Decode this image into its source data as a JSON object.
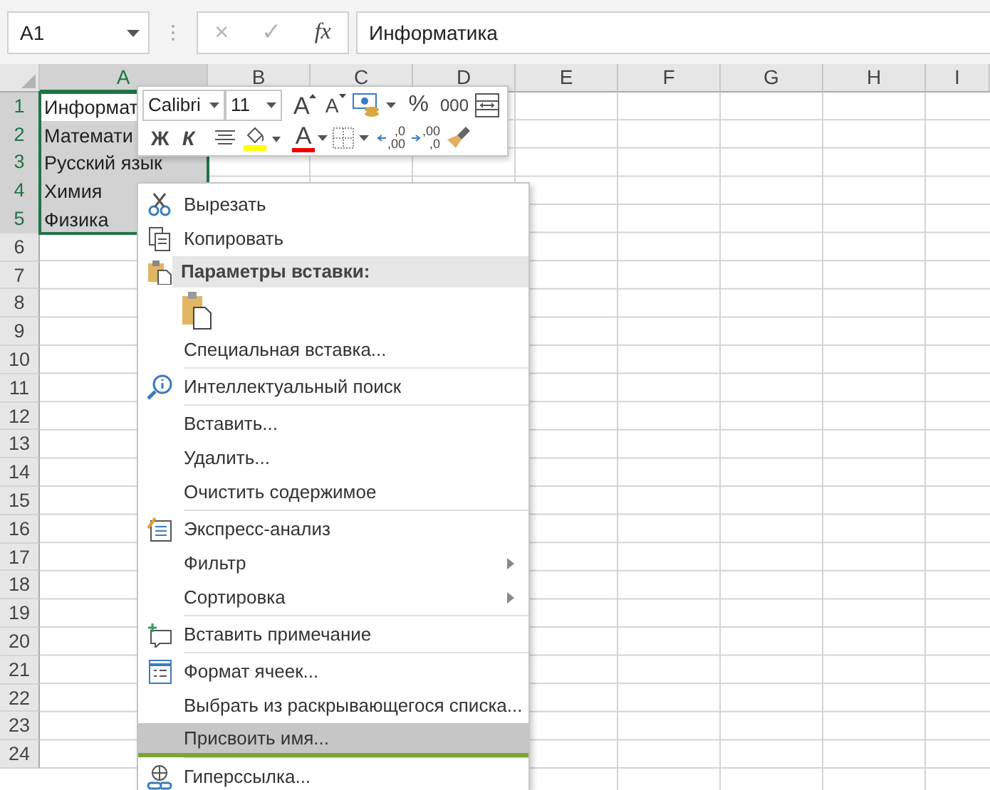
{
  "name_box": {
    "value": "A1"
  },
  "formula_bar": {
    "cancel": "×",
    "enter": "✓",
    "function": "fx",
    "value": "Информатика"
  },
  "columns": [
    {
      "label": "A",
      "selected": true
    },
    {
      "label": "B",
      "selected": false
    },
    {
      "label": "C",
      "selected": false
    },
    {
      "label": "D",
      "selected": false
    },
    {
      "label": "E",
      "selected": false
    },
    {
      "label": "F",
      "selected": false
    },
    {
      "label": "G",
      "selected": false
    },
    {
      "label": "H",
      "selected": false
    },
    {
      "label": "I",
      "selected": false
    }
  ],
  "rows": [
    {
      "label": "1",
      "selected": true,
      "cells": [
        {
          "text": "Информат",
          "selected": true,
          "active": true
        }
      ]
    },
    {
      "label": "2",
      "selected": true,
      "cells": [
        {
          "text": "Математи",
          "selected": true,
          "active": false
        }
      ]
    },
    {
      "label": "3",
      "selected": true,
      "cells": [
        {
          "text": "Русский язык",
          "selected": true,
          "active": false
        }
      ]
    },
    {
      "label": "4",
      "selected": true,
      "cells": [
        {
          "text": "Химия",
          "selected": true,
          "active": false
        }
      ]
    },
    {
      "label": "5",
      "selected": true,
      "cells": [
        {
          "text": "Физика",
          "selected": true,
          "active": false
        }
      ]
    },
    {
      "label": "6",
      "selected": false
    },
    {
      "label": "7",
      "selected": false
    },
    {
      "label": "8",
      "selected": false
    },
    {
      "label": "9",
      "selected": false
    },
    {
      "label": "10",
      "selected": false
    },
    {
      "label": "11",
      "selected": false
    },
    {
      "label": "12",
      "selected": false
    },
    {
      "label": "13",
      "selected": false
    },
    {
      "label": "14",
      "selected": false
    },
    {
      "label": "15",
      "selected": false
    },
    {
      "label": "16",
      "selected": false
    },
    {
      "label": "17",
      "selected": false
    },
    {
      "label": "18",
      "selected": false
    },
    {
      "label": "19",
      "selected": false
    },
    {
      "label": "20",
      "selected": false
    },
    {
      "label": "21",
      "selected": false
    },
    {
      "label": "22",
      "selected": false
    },
    {
      "label": "23",
      "selected": false
    },
    {
      "label": "24",
      "selected": false
    }
  ],
  "mini_toolbar": {
    "font": "Calibri",
    "size": "11",
    "grow_font": "A",
    "shrink_font": "A",
    "percent": "%",
    "thousands": "000",
    "bold": "Ж",
    "italic": "К",
    "font_color": "A",
    "increase_decimal": [
      ",0",
      ",00"
    ],
    "decrease_decimal": [
      ",00",
      ",0"
    ]
  },
  "context_menu": {
    "items": [
      {
        "kind": "command",
        "label": "Вырезать",
        "submenu": false,
        "selected": false
      },
      {
        "kind": "command",
        "label": "Копировать",
        "submenu": false,
        "selected": false
      },
      {
        "kind": "section",
        "label": "Параметры вставки:"
      },
      {
        "kind": "paste_options"
      },
      {
        "kind": "command",
        "label": "Специальная вставка...",
        "submenu": false,
        "selected": false
      },
      {
        "kind": "separator"
      },
      {
        "kind": "command",
        "label": "Интеллектуальный поиск",
        "submenu": false,
        "selected": false
      },
      {
        "kind": "separator"
      },
      {
        "kind": "command",
        "label": "Вставить...",
        "submenu": false,
        "selected": false
      },
      {
        "kind": "command",
        "label": "Удалить...",
        "submenu": false,
        "selected": false
      },
      {
        "kind": "command",
        "label": "Очистить содержимое",
        "submenu": false,
        "selected": false
      },
      {
        "kind": "separator"
      },
      {
        "kind": "command",
        "label": "Экспресс-анализ",
        "submenu": false,
        "selected": false
      },
      {
        "kind": "command",
        "label": "Фильтр",
        "submenu": true,
        "selected": false
      },
      {
        "kind": "command",
        "label": "Сортировка",
        "submenu": true,
        "selected": false
      },
      {
        "kind": "separator"
      },
      {
        "kind": "command",
        "label": "Вставить примечание",
        "submenu": false,
        "selected": false
      },
      {
        "kind": "separator"
      },
      {
        "kind": "command",
        "label": "Формат ячеек...",
        "submenu": false,
        "selected": false
      },
      {
        "kind": "command",
        "label": "Выбрать из раскрывающегося списка...",
        "submenu": false,
        "selected": false
      },
      {
        "kind": "command",
        "label": "Присвоить имя...",
        "submenu": false,
        "selected": true
      },
      {
        "kind": "separator"
      },
      {
        "kind": "command",
        "label": "Гиперссылка...",
        "submenu": false,
        "selected": false
      }
    ]
  }
}
